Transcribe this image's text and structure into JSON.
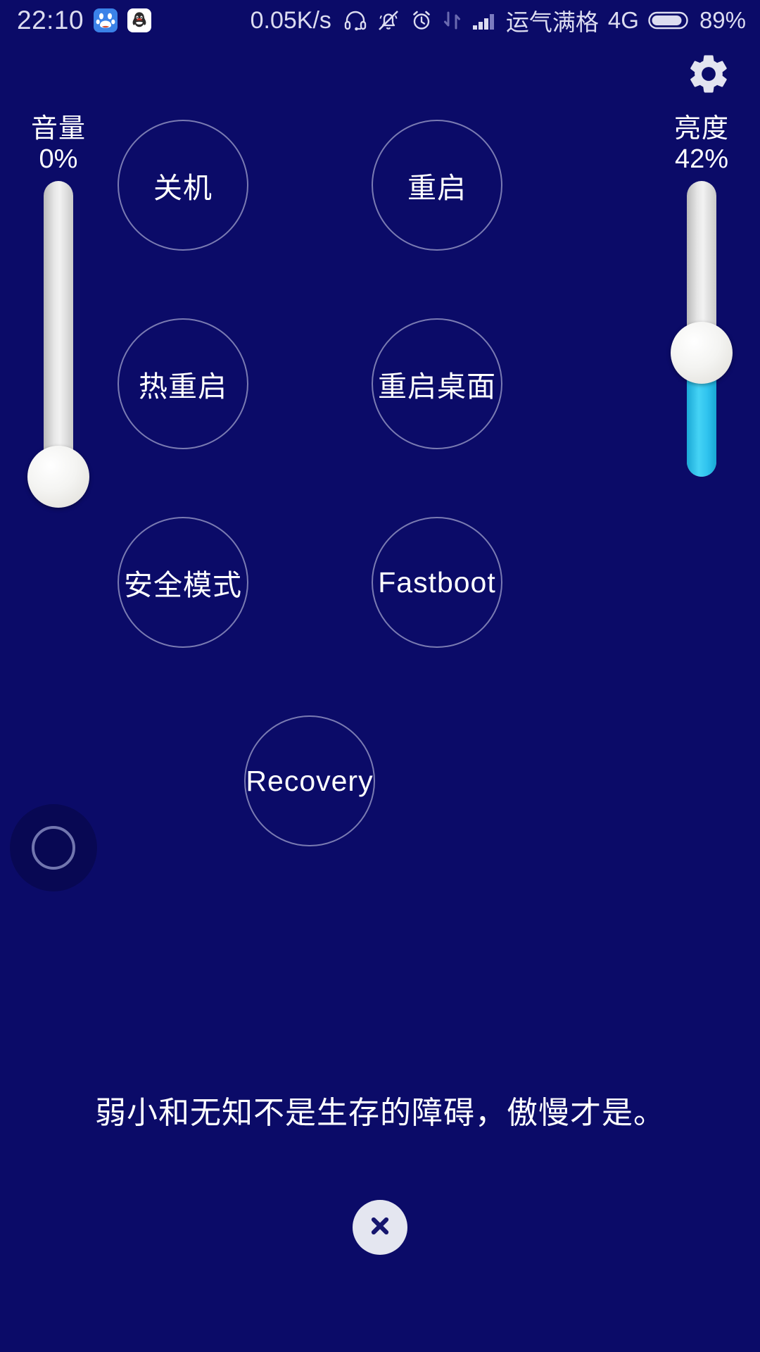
{
  "theme": {
    "background": "#0b0b68",
    "circle_border": "#bec0e1",
    "text": "#ffffff",
    "status_text": "#dcdcf0",
    "slider_track": "#e6e6e6",
    "slider_fill_cyan": "#2fc3ee",
    "close_button_bg": "#e4e6f0"
  },
  "statusbar": {
    "time": "22:10",
    "app_icons": [
      {
        "name": "baidu-app-icon",
        "label": "du"
      },
      {
        "name": "qq-app-icon",
        "label": "QQ"
      }
    ],
    "network_speed": "0.05K/s",
    "icons": [
      "headphone-icon",
      "bell-muted-icon",
      "alarm-clock-icon",
      "data-transfer-icon",
      "signal-bars-icon"
    ],
    "carrier": "运气满格",
    "network_type": "4G",
    "battery_percent": "89%"
  },
  "header": {
    "settings_icon": "gear-icon"
  },
  "sliders": {
    "volume": {
      "label": "音量",
      "value_text": "0%",
      "value": 0,
      "min": 0,
      "max": 100
    },
    "brightness": {
      "label": "亮度",
      "value_text": "42%",
      "value": 42,
      "min": 0,
      "max": 100
    }
  },
  "actions": [
    {
      "id": "power-off",
      "label": "关机"
    },
    {
      "id": "reboot",
      "label": "重启"
    },
    {
      "id": "hot-reboot",
      "label": "热重启"
    },
    {
      "id": "restart-launcher",
      "label": "重启桌面"
    },
    {
      "id": "safe-mode",
      "label": "安全模式"
    },
    {
      "id": "fastboot",
      "label": "Fastboot"
    },
    {
      "id": "recovery",
      "label": "Recovery"
    }
  ],
  "float_ball": {
    "name": "floating-assistive-ball"
  },
  "quote": {
    "text": "弱小和无知不是生存的障碍，傲慢才是。"
  },
  "close": {
    "icon": "close-icon",
    "label": "关闭"
  }
}
